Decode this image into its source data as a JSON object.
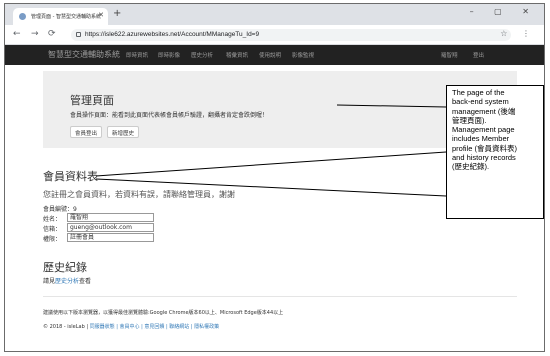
{
  "browser": {
    "tab_title": "管理頁面 - 智慧型交通輔助系統",
    "tab_close": "✕",
    "new_tab": "+",
    "window_controls": "– ▢ ✕",
    "back": "←",
    "forward": "→",
    "reload": "⟳",
    "url": "https://isle622.azurewebsites.net/Account/MManageTu_Id=9",
    "toolbar_right": "☆ ⋮"
  },
  "navbar": {
    "brand": "智慧型交通輔助系統",
    "links": [
      "即時資訊",
      "即時影像",
      "歷史分析",
      "稽彙資訊",
      "使用說明",
      "影像監視"
    ],
    "user": "羅智翔",
    "logout": "登出"
  },
  "jumbotron": {
    "title": "管理頁面",
    "desc": "會員操作頁面：能看到此頁面代表帳會員帳戶驗證，翻攝者肯定會跌倒喔！",
    "buttons": [
      "會員登出",
      "新增歷史"
    ]
  },
  "member": {
    "heading": "會員資料表",
    "subtitle": "您註冊之會員資料，若資料有誤，請聯絡管理員，謝謝",
    "id_line": "會員編號：9",
    "fields": [
      {
        "label": "姓名：",
        "value": "羅智翔"
      },
      {
        "label": "信箱：",
        "value": "gueng@outlook.com"
      },
      {
        "label": "權限：",
        "value": "註冊會員"
      }
    ]
  },
  "history": {
    "heading": "歷史紀錄",
    "prefix": "請見",
    "link": "歷史分析",
    "suffix": "查看"
  },
  "footer": {
    "note": "建議使用以下版本瀏覽器，以獲得最佳瀏覽體驗:Google Chrome版本60以上、Microsoft Edge版本44以上",
    "copyright": "© 2018 - isleLab | ",
    "links": "同服器狀態 | 會員中心 | 意見回饋 | 聯絡網站 | 隱私權政策"
  },
  "annotation": {
    "lines": [
      "The page of the",
      "back-end system",
      "management (後端",
      "管理頁面).",
      "Management page",
      "includes Member",
      "profile (會員資料表)",
      "and history records",
      "(歷史紀錄)."
    ]
  }
}
